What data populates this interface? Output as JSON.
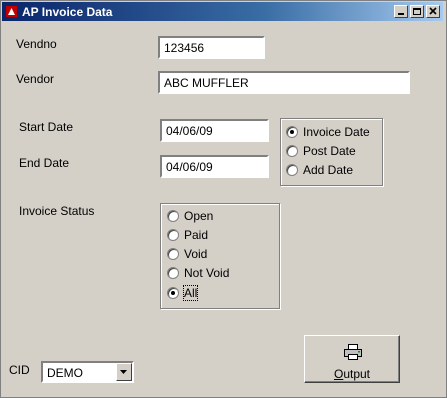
{
  "window": {
    "title": "AP Invoice Data"
  },
  "form": {
    "vendno_label": "Vendno",
    "vendno_value": "123456",
    "vendor_label": "Vendor",
    "vendor_value": "ABC MUFFLER",
    "start_date_label": "Start Date",
    "start_date_value": "04/06/09",
    "end_date_label": "End Date",
    "end_date_value": "04/06/09",
    "date_type": {
      "options": [
        "Invoice Date",
        "Post Date",
        "Add Date"
      ],
      "selected": "Invoice Date"
    },
    "invoice_status_label": "Invoice Status",
    "invoice_status": {
      "options": [
        "Open",
        "Paid",
        "Void",
        "Not Void",
        "All"
      ],
      "selected": "All"
    },
    "cid_label": "CID",
    "cid_value": "DEMO"
  },
  "buttons": {
    "output_label": "Output"
  },
  "icons": [
    "app-icon",
    "minimize-icon",
    "maximize-icon",
    "close-icon",
    "dropdown-arrow-icon",
    "printer-icon"
  ]
}
